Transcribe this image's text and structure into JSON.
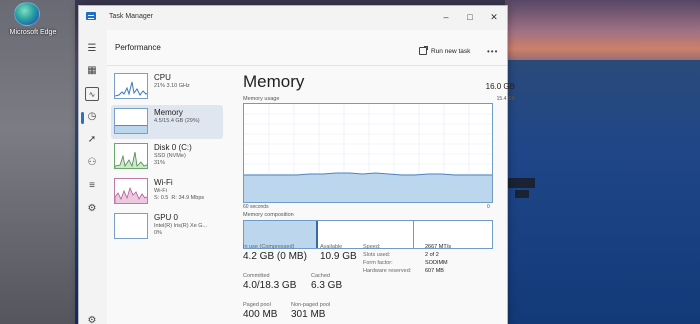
{
  "desktop": {
    "edge_label": "Microsoft Edge"
  },
  "window": {
    "title": "Task Manager",
    "controls": {
      "minimize": "–",
      "maximize": "□",
      "close": "✕"
    }
  },
  "rail": {
    "icons": [
      "hamburger-icon",
      "processes-icon",
      "performance-icon",
      "app-history-icon",
      "startup-icon",
      "users-icon",
      "details-icon",
      "services-icon",
      "settings-icon"
    ]
  },
  "header": {
    "title": "Performance",
    "run_new_task": "Run new task",
    "more": "•••"
  },
  "perf_items": [
    {
      "name": "CPU",
      "sub": "21%  3.10 GHz"
    },
    {
      "name": "Memory",
      "sub": "4.5/15.4 GB (29%)"
    },
    {
      "name": "Disk 0 (C:)",
      "sub": "SSD (NVMe)\n31%"
    },
    {
      "name": "Wi-Fi",
      "sub": "Wi-Fi\nS: 0.5  R: 34.9 Mbps"
    },
    {
      "name": "GPU 0",
      "sub": "Intel(R) Iris(R) Xe G...\n0%"
    }
  ],
  "memory": {
    "title": "Memory",
    "total": "16.0 GB",
    "usage_label": "Memory usage",
    "usage_max": "15.4 GB",
    "axis_left": "60 seconds",
    "axis_right": "0",
    "composition_label": "Memory composition",
    "usage_fraction": 0.29,
    "stats": {
      "in_use_label": "In use (Compressed)",
      "in_use_value": "4.2 GB (0 MB)",
      "available_label": "Available",
      "available_value": "10.9 GB",
      "committed_label": "Committed",
      "committed_value": "4.0/18.3 GB",
      "cached_label": "Cached",
      "cached_value": "6.3 GB",
      "paged_label": "Paged pool",
      "paged_value": "400 MB",
      "nonpaged_label": "Non-paged pool",
      "nonpaged_value": "301 MB"
    },
    "kv": [
      {
        "label": "Speed:",
        "value": "2667 MT/s"
      },
      {
        "label": "Slots used:",
        "value": "2 of 2"
      },
      {
        "label": "Form factor:",
        "value": "SODIMM"
      },
      {
        "label": "Hardware reserved:",
        "value": "607 MB"
      }
    ]
  },
  "colors": {
    "accent": "#2f6fc0",
    "graph_border": "#6e9bc9",
    "graph_fill": "#bcd6ee",
    "wifi_graph": "#c07aa8",
    "disk_graph": "#6aa86a"
  }
}
